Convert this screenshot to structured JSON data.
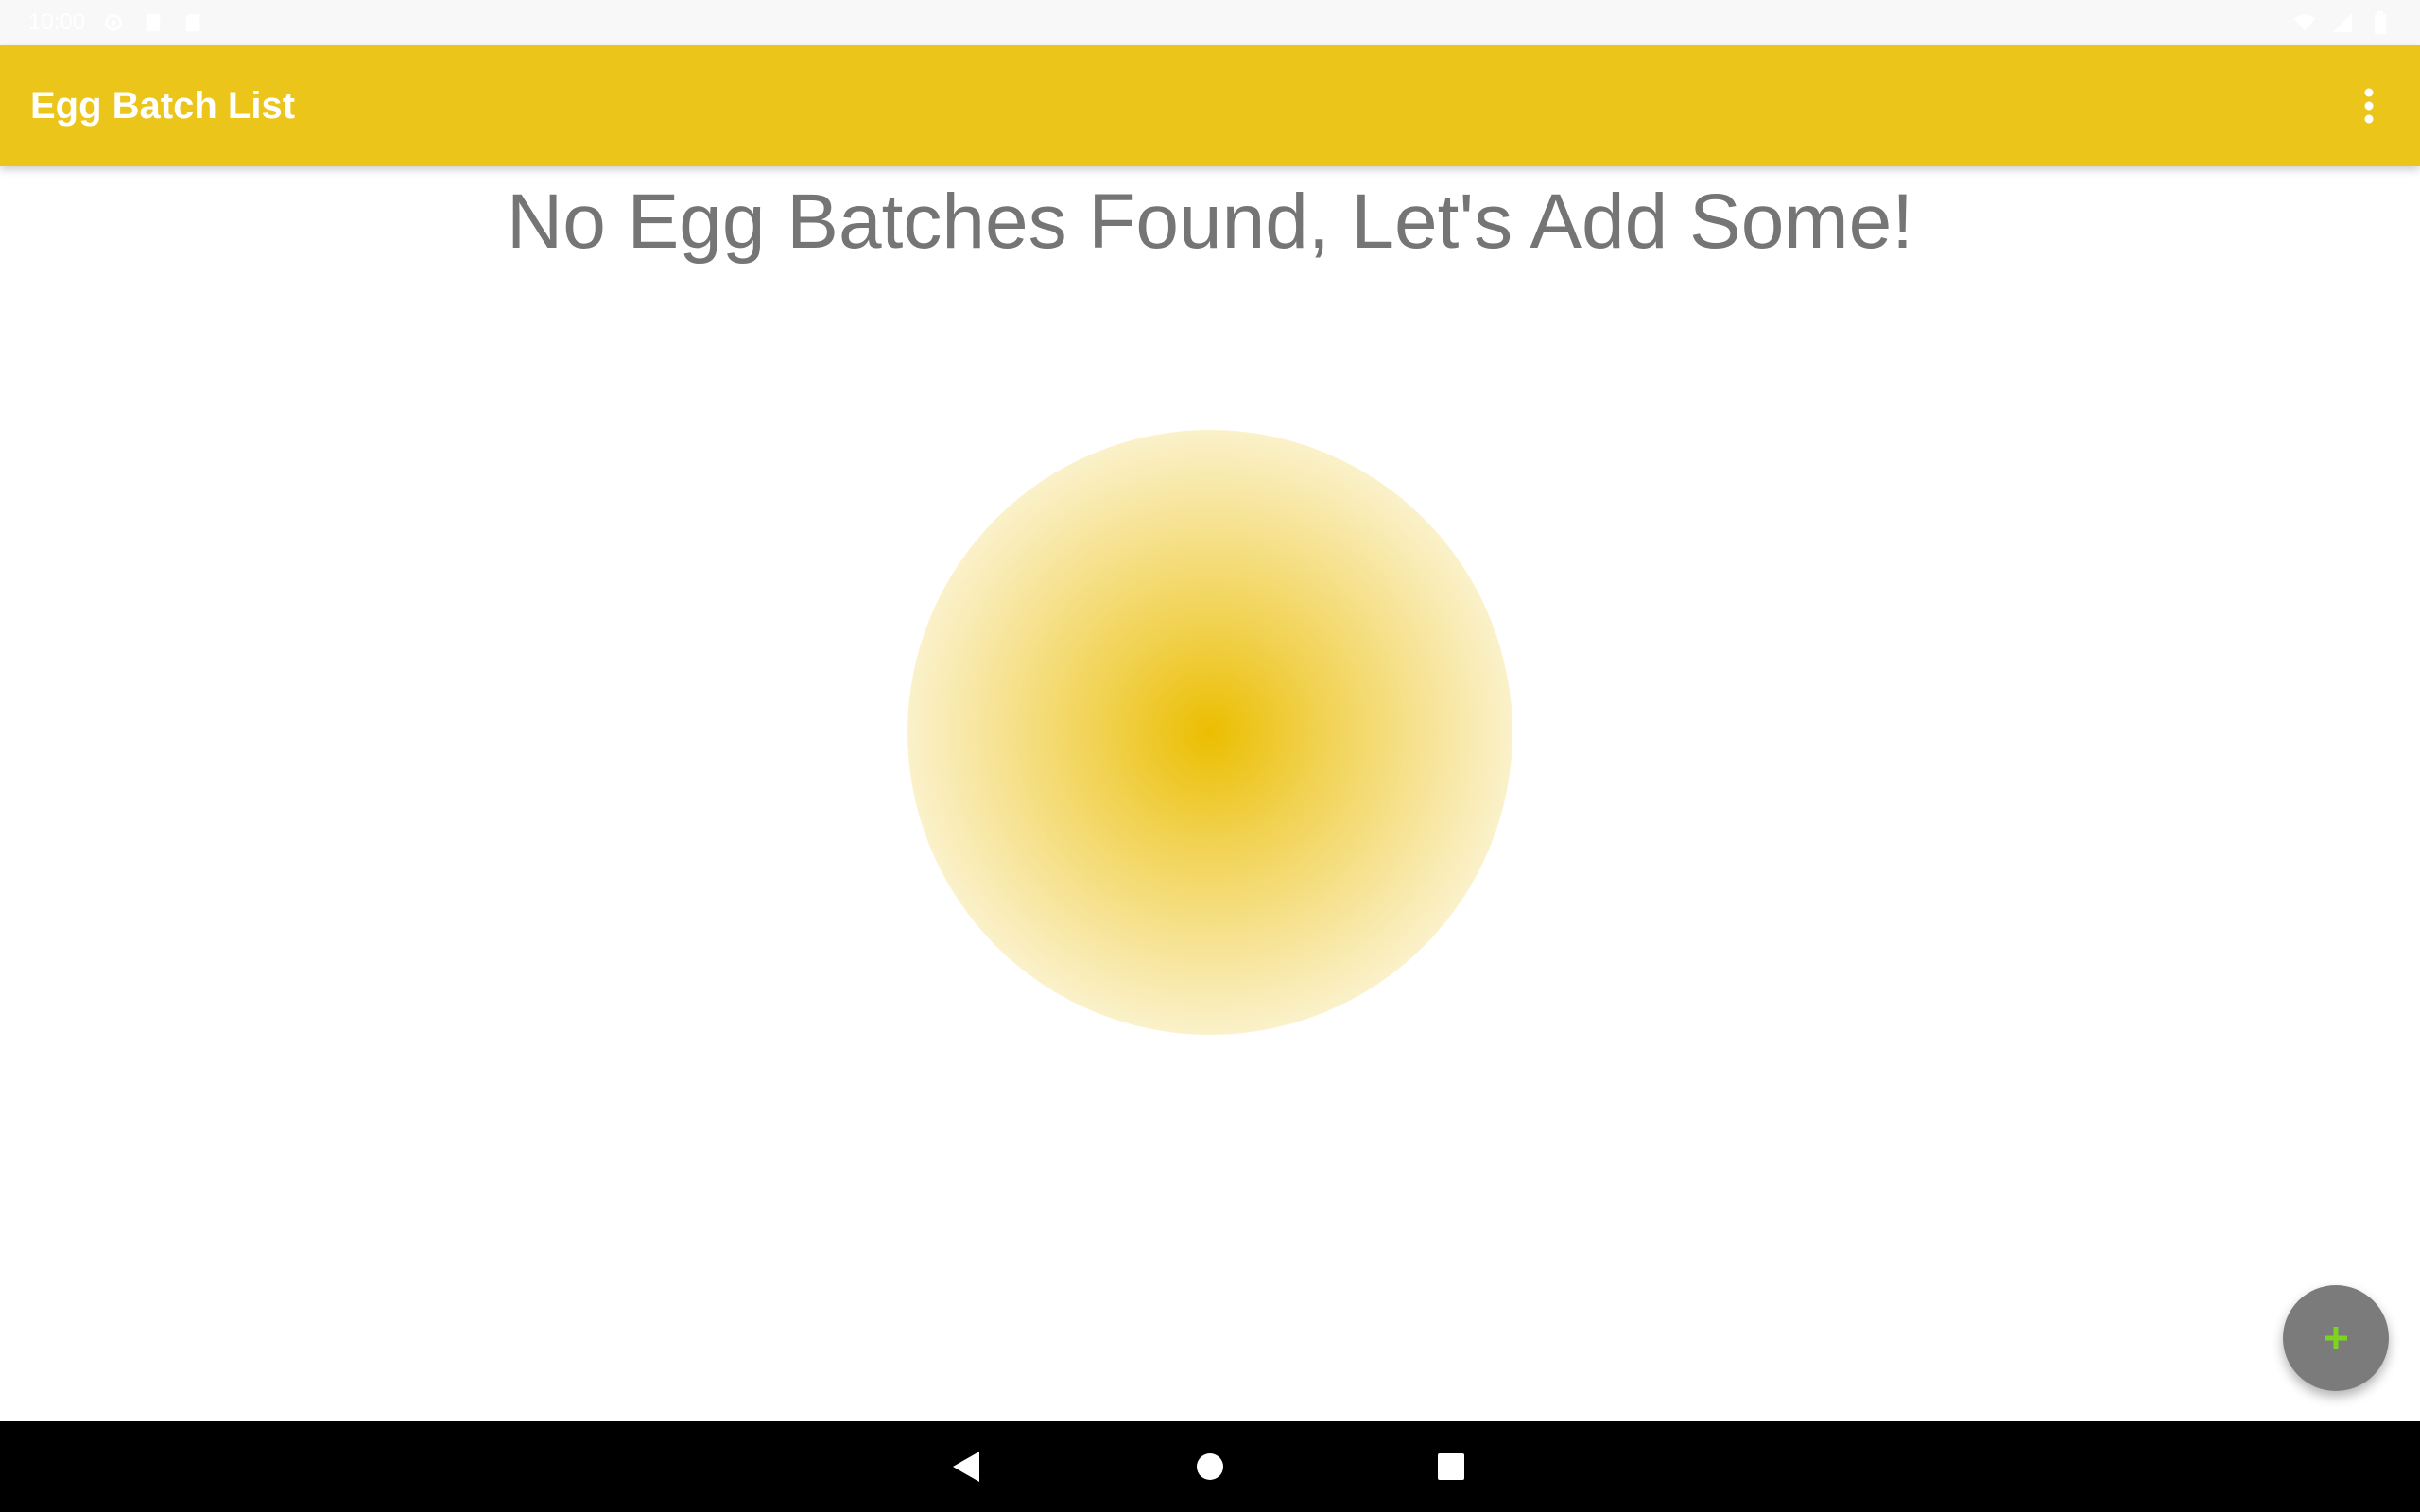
{
  "status_bar": {
    "time": "10:00",
    "left_icons": [
      "settings-icon",
      "sim-card-icon",
      "sd-card-icon"
    ],
    "right_icons": [
      "wifi-icon",
      "signal-icon",
      "battery-icon"
    ]
  },
  "app_bar": {
    "title": "Egg Batch List",
    "menu_icon": "more-vert-icon",
    "color": "#EBC51A"
  },
  "main": {
    "empty_message": "No Egg Batches Found, Let's Add Some!",
    "illustration": "egg-yolk-gradient",
    "yolk_color": "#EBBE00"
  },
  "fab": {
    "icon": "plus-icon",
    "background": "#7B7B7B",
    "icon_color": "#7ED321"
  },
  "nav_bar": {
    "buttons": [
      "back-icon",
      "home-icon",
      "recents-icon"
    ]
  }
}
